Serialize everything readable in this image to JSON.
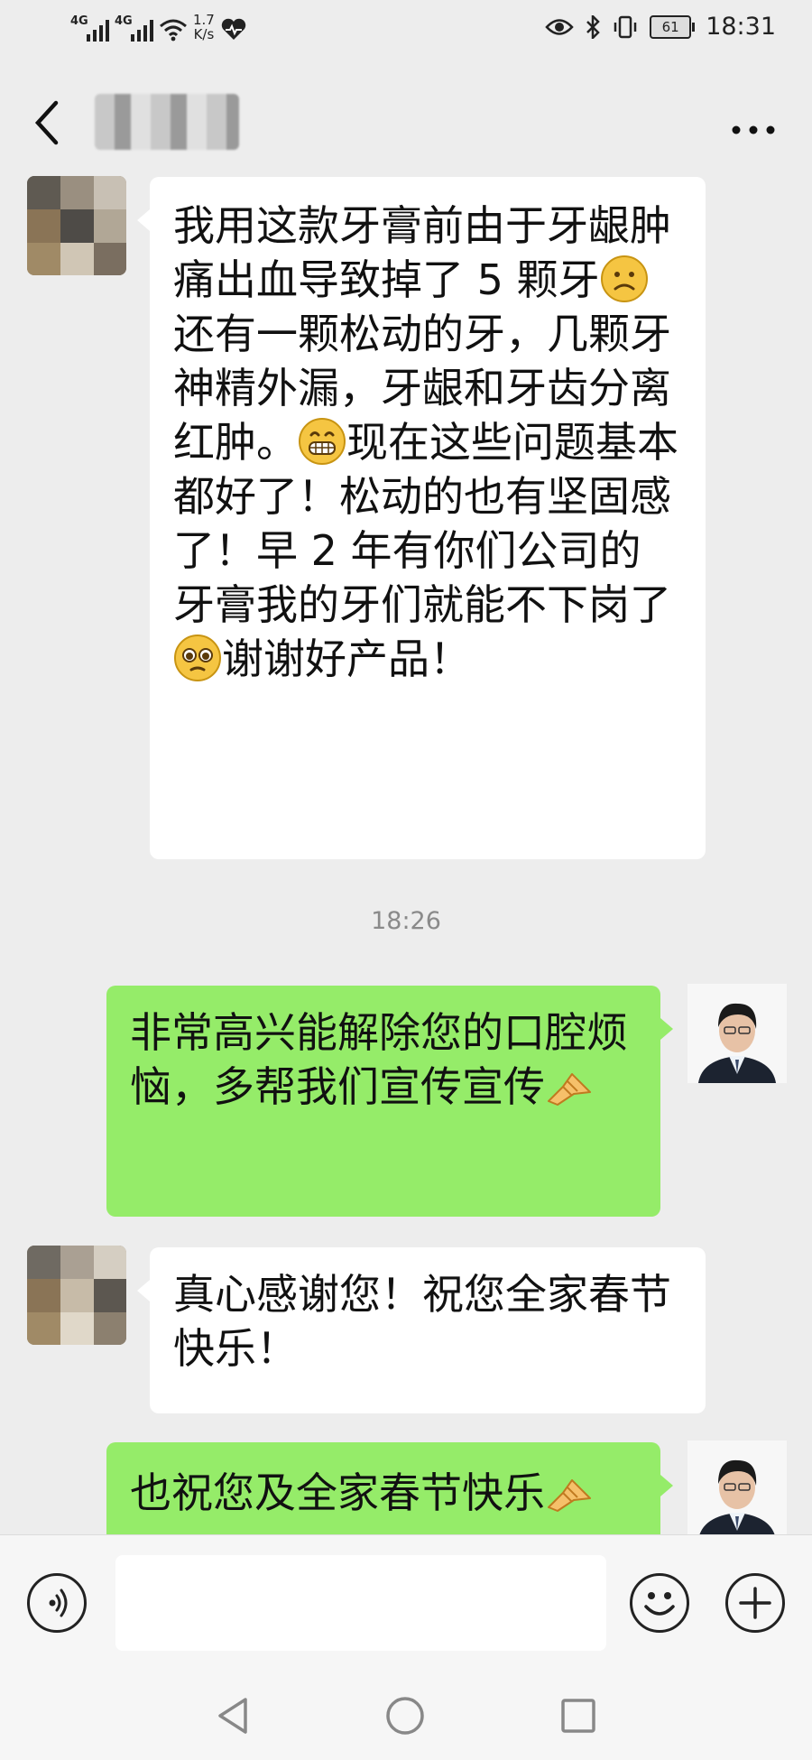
{
  "status_bar": {
    "signal1_label": "4G",
    "signal2_label": "4G",
    "speed_value": "1.7",
    "speed_unit": "K/s",
    "battery_level": "61",
    "time": "18:31"
  },
  "header": {
    "contact_name": "",
    "back_icon": "chevron-left-icon",
    "more_icon": "ellipsis-icon"
  },
  "messages": [
    {
      "side": "in",
      "parts": [
        "我用这款牙膏前由于牙龈肿痛出血导致掉了 5 颗牙",
        "还有一颗松动的牙，几颗牙神精外漏，牙龈和牙齿分离红肿。",
        "现在这些问题基本都好了！松动的也有坚固感了！早 2 年有你们公司的牙膏我的牙们就能不下岗了",
        "谢谢好产品！"
      ],
      "emojis": [
        "sad-face-emoji",
        "grin-face-emoji",
        "pleading-face-emoji"
      ]
    },
    {
      "side": "out",
      "parts": [
        "非常高兴能解除您的口腔烦恼，多帮我们宣传宣传"
      ],
      "emojis": [
        "pointing-hand-emoji"
      ]
    },
    {
      "side": "in",
      "parts": [
        "真心感谢您！祝您全家春节快乐！"
      ]
    },
    {
      "side": "out",
      "parts": [
        "也祝您及全家春节快乐"
      ],
      "emojis": [
        "pointing-hand-emoji"
      ]
    }
  ],
  "timestamp": "18:26",
  "input_bar": {
    "voice_icon": "voice-icon",
    "emoji_icon": "smiley-icon",
    "plus_icon": "plus-icon",
    "text_value": ""
  },
  "nav": {
    "back_icon": "triangle-back-icon",
    "home_icon": "circle-home-icon",
    "recents_icon": "square-recents-icon"
  },
  "colors": {
    "background": "#ededed",
    "incoming_bubble": "#ffffff",
    "outgoing_bubble": "#95ec69"
  }
}
